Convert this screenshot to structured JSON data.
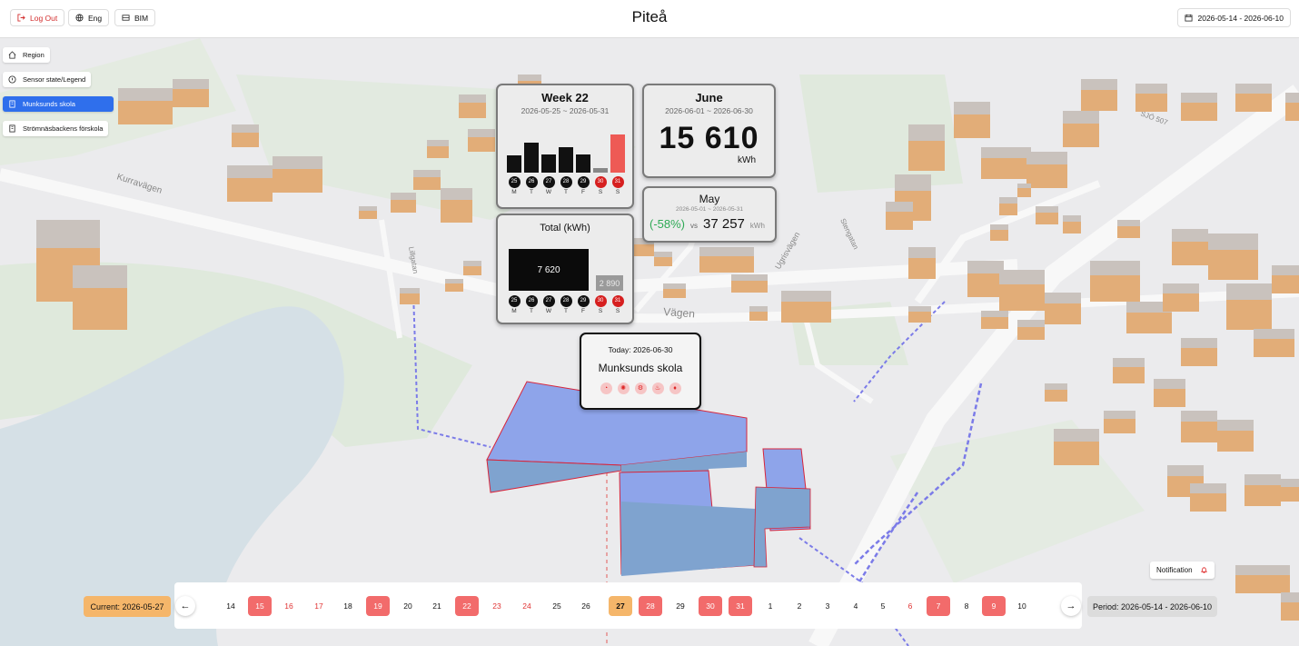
{
  "header": {
    "logout_label": "Log Out",
    "lang_label": "Eng",
    "bim_label": "BIM",
    "title": "Piteå",
    "period_label": "2026-05-14 - 2026-06-10"
  },
  "sidebar": {
    "items": [
      {
        "label": "Region",
        "icon": "home-icon"
      },
      {
        "label": "Sensor state/Legend",
        "icon": "info-icon"
      },
      {
        "label": "Munksunds skola",
        "icon": "building-icon",
        "active": true
      },
      {
        "label": "Strömnäsbackens förskola",
        "icon": "building-icon"
      }
    ]
  },
  "map": {
    "street_labels": [
      "Kurravägen",
      "Vägen",
      "Stengatan",
      "Lillgatan",
      "Ugrisvägen",
      "SJÖ 507"
    ]
  },
  "week_card": {
    "title": "Week 22",
    "range": "2026-05-25 ~ 2026-05-31",
    "bars": [
      0.42,
      0.72,
      0.43,
      0.6,
      0.43,
      0.1,
      0.92
    ],
    "days": [
      {
        "num": "25",
        "letter": "M",
        "red": false
      },
      {
        "num": "26",
        "letter": "T",
        "red": false
      },
      {
        "num": "27",
        "letter": "W",
        "red": false
      },
      {
        "num": "28",
        "letter": "T",
        "red": false
      },
      {
        "num": "29",
        "letter": "F",
        "red": false
      },
      {
        "num": "30",
        "letter": "S",
        "red": true
      },
      {
        "num": "31",
        "letter": "S",
        "red": true
      }
    ]
  },
  "total_card": {
    "title": "Total (kWh)",
    "weekday_value": "7 620",
    "weekend_value": "2 890"
  },
  "june_card": {
    "title": "June",
    "range": "2026-06-01 ~ 2026-06-30",
    "value": "15 610",
    "unit": "kWh"
  },
  "may_card": {
    "title": "May",
    "range": "2026-05-01 ~ 2026-05-31",
    "change": "(-58%)",
    "vs": "vs",
    "value": "37 257",
    "unit": "kWh"
  },
  "today_card": {
    "date": "Today: 2026-06-30",
    "name": "Munksunds skola",
    "icons": [
      "gauge-icon",
      "sun-icon",
      "gear-icon",
      "person-icon",
      "drop-icon"
    ]
  },
  "notification": {
    "label": "Notification"
  },
  "timeline": {
    "current": "Current: 2026-05-27",
    "period": "Period: 2026-05-14 - 2026-06-10",
    "days": [
      {
        "label": "14",
        "style": "plain"
      },
      {
        "label": "15",
        "style": "pill"
      },
      {
        "label": "16",
        "style": "red"
      },
      {
        "label": "17",
        "style": "red"
      },
      {
        "label": "18",
        "style": "plain"
      },
      {
        "label": "19",
        "style": "pill"
      },
      {
        "label": "20",
        "style": "plain"
      },
      {
        "label": "21",
        "style": "plain"
      },
      {
        "label": "22",
        "style": "pill"
      },
      {
        "label": "23",
        "style": "red"
      },
      {
        "label": "24",
        "style": "red"
      },
      {
        "label": "25",
        "style": "plain"
      },
      {
        "label": "26",
        "style": "plain"
      },
      {
        "label": "27",
        "style": "current"
      },
      {
        "label": "28",
        "style": "pill"
      },
      {
        "label": "29",
        "style": "plain"
      },
      {
        "label": "30",
        "style": "pill"
      },
      {
        "label": "31",
        "style": "pill"
      },
      {
        "label": "1",
        "style": "plain"
      },
      {
        "label": "2",
        "style": "plain"
      },
      {
        "label": "3",
        "style": "plain"
      },
      {
        "label": "4",
        "style": "plain"
      },
      {
        "label": "5",
        "style": "plain"
      },
      {
        "label": "6",
        "style": "red"
      },
      {
        "label": "7",
        "style": "pill"
      },
      {
        "label": "8",
        "style": "plain"
      },
      {
        "label": "9",
        "style": "pill"
      },
      {
        "label": "10",
        "style": "plain"
      }
    ]
  },
  "colors": {
    "accent_blue": "#2f6fec",
    "current_orange": "#f5b66a",
    "alert_red": "#f26b6b",
    "building": "#e2ad78",
    "selected_building": "#8ea0e6"
  }
}
